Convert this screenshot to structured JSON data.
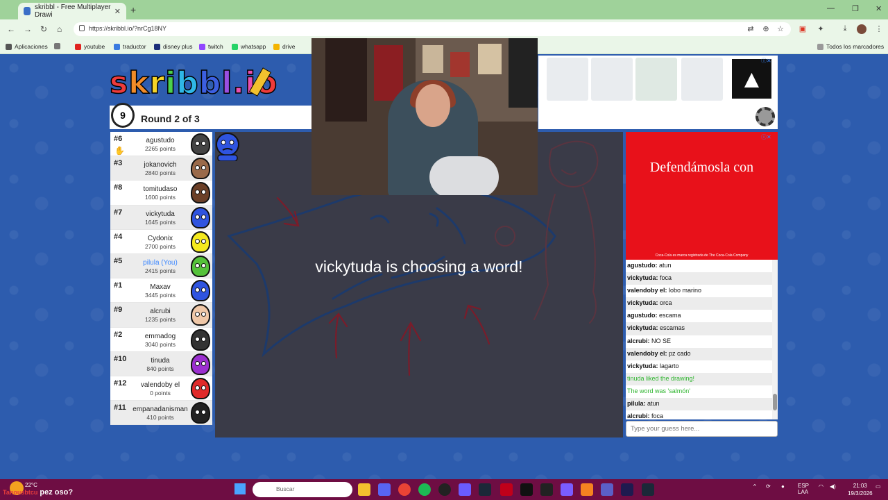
{
  "browser": {
    "tab_title": "skribbl - Free Multiplayer Drawi",
    "url": "https://skribbl.io/?nrCg18NY",
    "bookmarks": [
      "Aplicaciones",
      "youtube",
      "traductor",
      "disney plus",
      "twitch",
      "whatsapp",
      "drive"
    ],
    "bookmarks_right": "Todos los marcadores"
  },
  "game": {
    "logo": "skribbl.io",
    "timer": "9",
    "round": "Round 2 of 3",
    "status": "vickytuda is choosing a word!",
    "players": [
      {
        "rank": "#6",
        "name": "agustudo",
        "points": "2265 points",
        "color": "#444444",
        "you": false
      },
      {
        "rank": "#3",
        "name": "jokanovich",
        "points": "2840 points",
        "color": "#9a6a4a",
        "you": false
      },
      {
        "rank": "#8",
        "name": "tomitudaso",
        "points": "1600 points",
        "color": "#6b3f27",
        "you": false
      },
      {
        "rank": "#7",
        "name": "vickytuda",
        "points": "1645 points",
        "color": "#2f54e0",
        "you": false
      },
      {
        "rank": "#4",
        "name": "Cydonix",
        "points": "2700 points",
        "color": "#f5ea1f",
        "you": false
      },
      {
        "rank": "#5",
        "name": "pilula (You)",
        "points": "2415 points",
        "color": "#55c23a",
        "you": true
      },
      {
        "rank": "#1",
        "name": "Maxav",
        "points": "3445 points",
        "color": "#2f54e0",
        "you": false
      },
      {
        "rank": "#9",
        "name": "alcrubi",
        "points": "1235 points",
        "color": "#f0c8a8",
        "you": false
      },
      {
        "rank": "#2",
        "name": "emmadog",
        "points": "3040 points",
        "color": "#333333",
        "you": false
      },
      {
        "rank": "#10",
        "name": "tinuda",
        "points": "840 points",
        "color": "#9b2fd0",
        "you": false
      },
      {
        "rank": "#12",
        "name": "valendoby el",
        "points": "0 points",
        "color": "#e02a2a",
        "you": false
      },
      {
        "rank": "#11",
        "name": "empanadanisman",
        "points": "410 points",
        "color": "#222222",
        "you": false
      }
    ]
  },
  "chat": {
    "messages": [
      {
        "author": "agustudo:",
        "text": "atun",
        "type": "normal"
      },
      {
        "author": "vickytuda:",
        "text": "foca",
        "type": "normal"
      },
      {
        "author": "valendoby el:",
        "text": "lobo marino",
        "type": "normal"
      },
      {
        "author": "vickytuda:",
        "text": "orca",
        "type": "normal"
      },
      {
        "author": "agustudo:",
        "text": "escama",
        "type": "normal"
      },
      {
        "author": "vickytuda:",
        "text": "escamas",
        "type": "normal"
      },
      {
        "author": "alcrubi:",
        "text": "NO SE",
        "type": "normal"
      },
      {
        "author": "valendoby el:",
        "text": "pz cado",
        "type": "normal"
      },
      {
        "author": "vickytuda:",
        "text": "lagarto",
        "type": "normal"
      },
      {
        "author": "",
        "text": "tinuda liked the drawing!",
        "type": "system"
      },
      {
        "author": "",
        "text": "The word was 'salmón'",
        "type": "system"
      },
      {
        "author": "pilula:",
        "text": "atun",
        "type": "normal"
      },
      {
        "author": "alcrubi:",
        "text": "foca",
        "type": "normal"
      }
    ],
    "placeholder": "Type your guess here..."
  },
  "ad": {
    "headline": "Defendámosla con",
    "fineprint": "Coca-Cola es marca registrada de The Coca-Cola Company"
  },
  "taskbar": {
    "temp": "22°C",
    "caption_prefix": "Tanousbtcu",
    "caption": "pez oso?",
    "search_placeholder": "Buscar",
    "lang": "ESP",
    "lang2": "LAA",
    "time": "21:03",
    "date": "19/3/2026"
  }
}
